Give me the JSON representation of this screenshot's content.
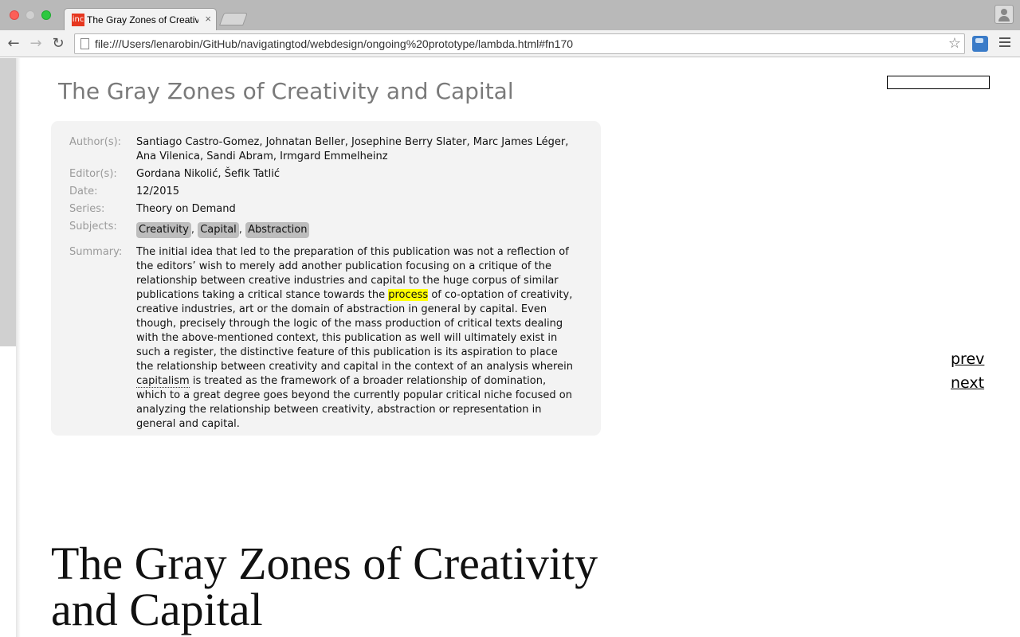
{
  "browser": {
    "tab_title": "The Gray Zones of Creativity and Capital",
    "favicon_label": "inc",
    "tab_close": "×",
    "url": "file:///Users/lenarobin/GitHub/navigatingtod/webdesign/ongoing%20prototype/lambda.html#fn170",
    "icons": {
      "back": "←",
      "forward": "→",
      "reload": "↻",
      "bookmark": "☆"
    }
  },
  "page": {
    "title": "The Gray Zones of Creativity and Capital",
    "meta": {
      "authors_label": "Author(s):",
      "authors": "Santiago Castro-Gomez, Johnatan Beller, Josephine Berry Slater, Marc James Léger, Ana Vilenica, Sandi Abram, Irmgard Emmelheinz",
      "editors_label": "Editor(s):",
      "editors": "Gordana Nikolić, Šefik Tatlić",
      "date_label": "Date:",
      "date": "12/2015",
      "series_label": "Series:",
      "series": "Theory on Demand",
      "subjects_label": "Subjects:",
      "subjects": [
        "Creativity",
        "Capital",
        "Abstraction"
      ],
      "subject_separator": ",",
      "summary_label": "Summary:",
      "summary": {
        "part1": "The initial idea that led to the preparation of this publication was not a reflection of the editors’ wish to merely add another publication focusing on a critique of the relationship between creative industries and capital to the huge corpus of similar publications taking a critical stance towards the ",
        "highlight": "process",
        "part2": " of co-optation of creativity, creative industries, art or the domain of abstraction in general by capital. Even though, precisely through the logic of the mass production of critical texts dealing with the above-mentioned context, this publication as well will ultimately exist in such a register, the distinctive feature of this publication is its aspiration to place the relationship between creativity and capital in the context of an analysis wherein ",
        "link": "capitalism",
        "part3": " is treated as the framework of a broader relationship of domination, which to a great degree goes beyond the currently popular critical niche focused on analyzing the relationship between creativity, abstraction or representation in general and capital."
      }
    },
    "pager": {
      "prev": "prev",
      "next": "next"
    },
    "heading": "The Gray Zones of Creativity and Capital"
  }
}
